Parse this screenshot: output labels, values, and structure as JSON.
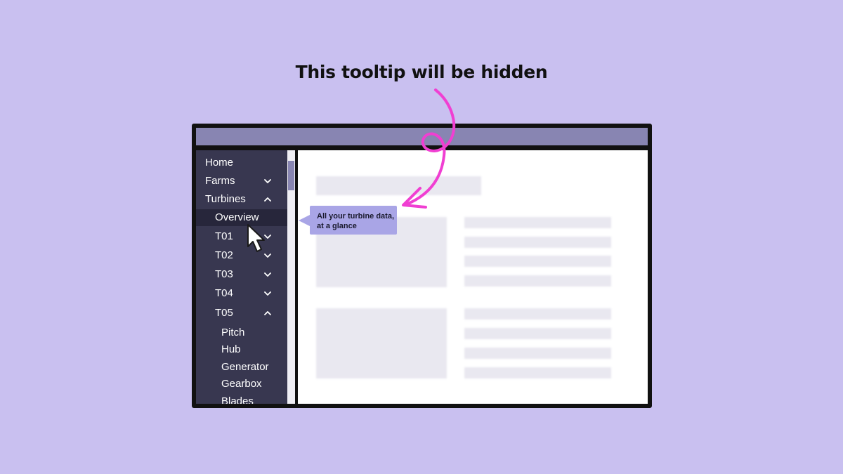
{
  "headline": "This tooltip will be hidden",
  "sidebar": {
    "items": [
      {
        "label": "Home"
      },
      {
        "label": "Farms"
      },
      {
        "label": "Turbines"
      },
      {
        "label": "Overview"
      },
      {
        "label": "T01"
      },
      {
        "label": "T02"
      },
      {
        "label": "T03"
      },
      {
        "label": "T04"
      },
      {
        "label": "T05"
      },
      {
        "label": "Pitch"
      },
      {
        "label": "Hub"
      },
      {
        "label": "Generator"
      },
      {
        "label": "Gearbox"
      },
      {
        "label": "Blades"
      }
    ]
  },
  "tooltip": {
    "line1": "All your turbine data,",
    "line2": "at a glance"
  },
  "icons": {
    "expand": "chevron-down-icon",
    "collapse": "chevron-up-icon",
    "cursor": "mouse-pointer-icon",
    "annotation": "curly-arrow-icon"
  },
  "colors": {
    "background": "#c9c0f0",
    "sidebar": "#383750",
    "titlebar": "#8885b2",
    "tooltip": "#a9a5e6",
    "annotation_arrow": "#f03fd2"
  }
}
